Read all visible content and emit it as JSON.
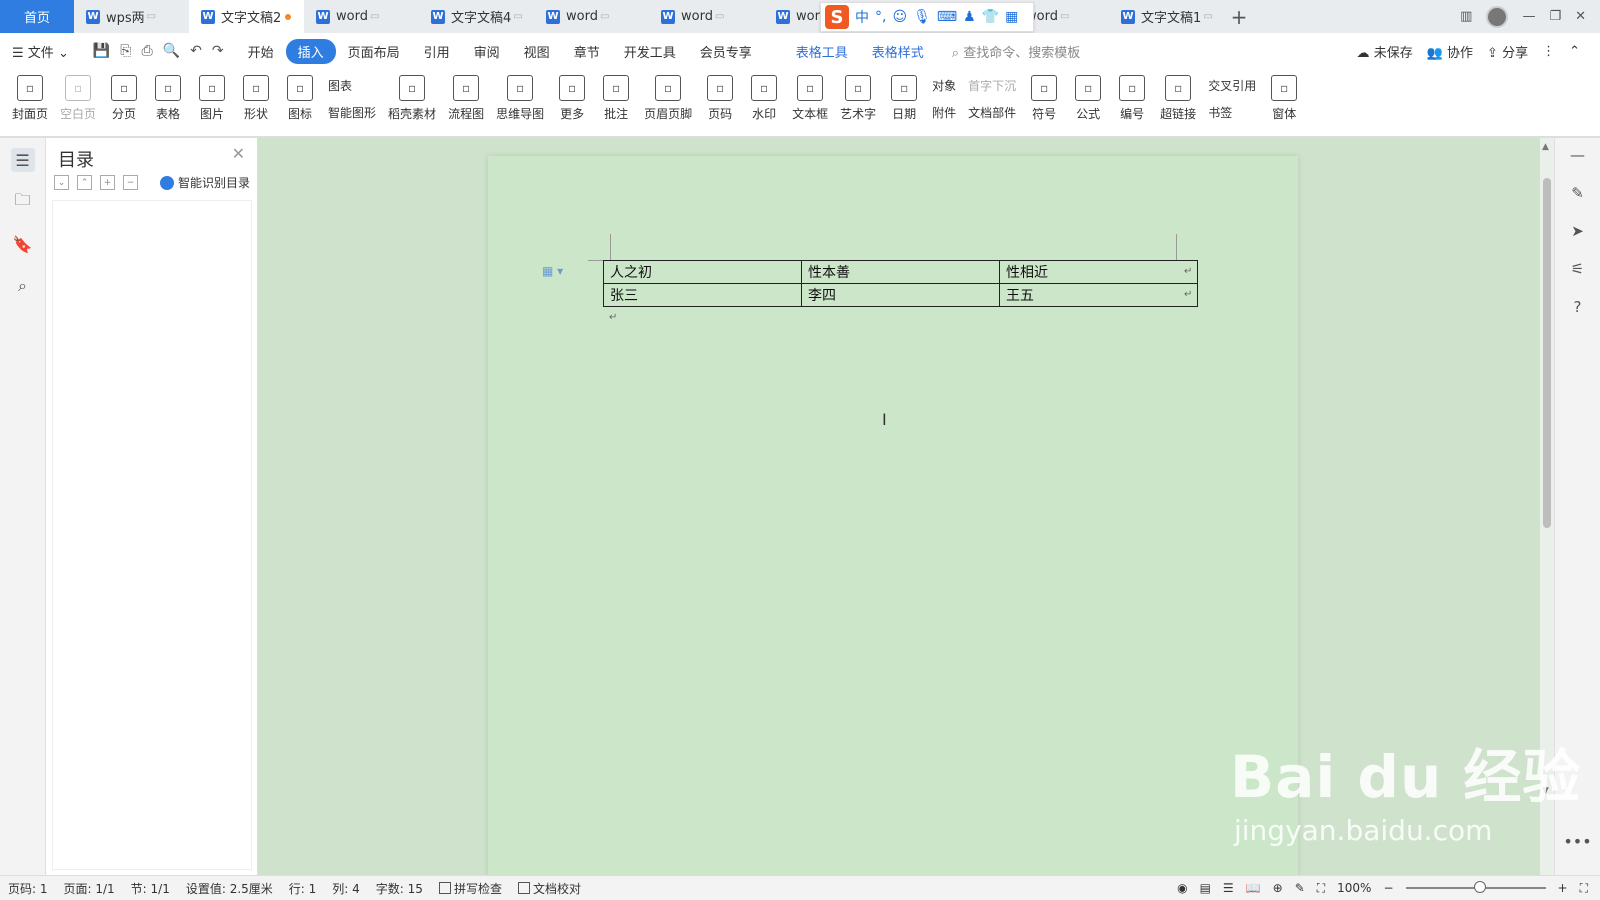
{
  "tabs": {
    "home": "首页",
    "items": [
      {
        "label": "wps两",
        "active": false,
        "dot": false
      },
      {
        "label": "文字文稿2",
        "active": true,
        "dot": true
      },
      {
        "label": "word",
        "active": false,
        "dot": false
      },
      {
        "label": "文字文稿4",
        "active": false,
        "dot": false
      },
      {
        "label": "word",
        "active": false,
        "dot": false
      },
      {
        "label": "word",
        "active": false,
        "dot": false
      },
      {
        "label": "wor",
        "active": false,
        "dot": false
      },
      {
        "label": "ord",
        "active": false,
        "dot": false
      },
      {
        "label": "word",
        "active": false,
        "dot": false
      },
      {
        "label": "文字文稿1",
        "active": false,
        "dot": false
      }
    ],
    "add": "+"
  },
  "ime": {
    "logo": "S",
    "mode": "中",
    "punct": "°,"
  },
  "menu": {
    "file": "文件",
    "items": [
      "开始",
      "插入",
      "页面布局",
      "引用",
      "审阅",
      "视图",
      "章节",
      "开发工具",
      "会员专享"
    ],
    "active": "插入",
    "context_tabs": [
      "表格工具",
      "表格样式"
    ],
    "search_placeholder": "查找命令、搜索模板",
    "right": [
      "未保存",
      "协作",
      "分享"
    ]
  },
  "ribbon": {
    "buttons_a": [
      {
        "label": "封面页",
        "gray": false
      },
      {
        "label": "空白页",
        "gray": true
      },
      {
        "label": "分页",
        "gray": false
      },
      {
        "label": "表格",
        "gray": false
      },
      {
        "label": "图片",
        "gray": false
      },
      {
        "label": "形状",
        "gray": false
      },
      {
        "label": "图标",
        "gray": false
      }
    ],
    "stack_a": [
      "图表",
      "智能图形"
    ],
    "buttons_b": [
      {
        "label": "稻壳素材"
      },
      {
        "label": "流程图"
      },
      {
        "label": "思维导图"
      },
      {
        "label": "更多"
      },
      {
        "label": "批注"
      },
      {
        "label": "页眉页脚"
      },
      {
        "label": "页码"
      },
      {
        "label": "水印"
      },
      {
        "label": "文本框"
      },
      {
        "label": "艺术字"
      },
      {
        "label": "日期"
      }
    ],
    "stack_b": [
      "对象",
      "附件"
    ],
    "stack_c": [
      "首字下沉",
      "文档部件"
    ],
    "buttons_c": [
      {
        "label": "符号"
      },
      {
        "label": "公式"
      },
      {
        "label": "编号"
      },
      {
        "label": "超链接"
      }
    ],
    "stack_d": [
      "交叉引用",
      "书签"
    ],
    "buttons_d": [
      {
        "label": "窗体"
      }
    ]
  },
  "toc": {
    "title": "目录",
    "smart_label": "智能识别目录"
  },
  "document": {
    "table": [
      [
        "人之初",
        "性本善",
        "性相近"
      ],
      [
        "张三",
        "李四",
        "王五"
      ]
    ]
  },
  "watermark": {
    "big": "Bai du 经验",
    "small": "jingyan.baidu.com"
  },
  "status": {
    "page_num": "页码: 1",
    "pages": "页面: 1/1",
    "section": "节: 1/1",
    "setting": "设置值: 2.5厘米",
    "row": "行: 1",
    "col": "列: 4",
    "words": "字数: 15",
    "spell": "拼写检查",
    "proof": "文档校对",
    "zoom": "100%"
  }
}
